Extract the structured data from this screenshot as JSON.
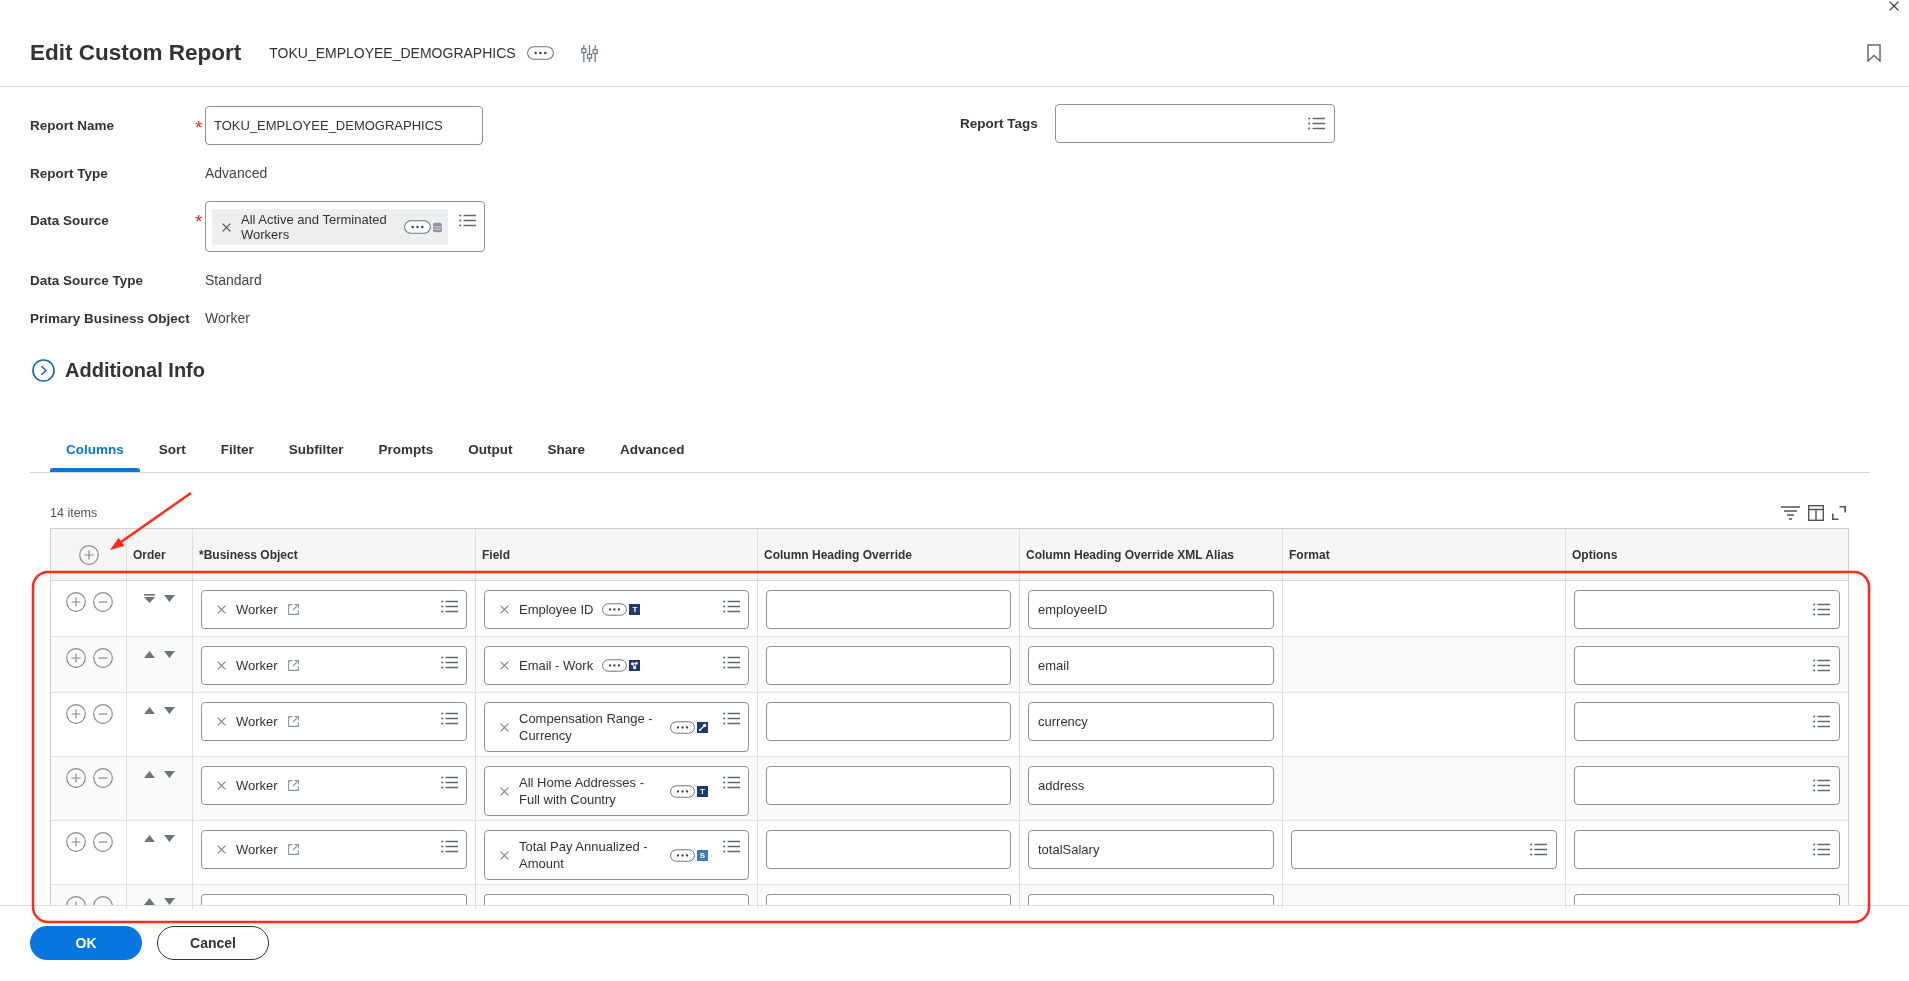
{
  "header": {
    "title": "Edit Custom Report",
    "subtitle": "TOKU_EMPLOYEE_DEMOGRAPHICS"
  },
  "form": {
    "fields": [
      {
        "label": "Report Name",
        "required_mark": "*",
        "kind": "text_input",
        "value": "TOKU_EMPLOYEE_DEMOGRAPHICS"
      },
      {
        "label": "Report Type",
        "kind": "static",
        "value": "Advanced"
      },
      {
        "label": "Data Source",
        "required_mark": "*",
        "kind": "chip_select",
        "value": "All Active and Terminated Workers"
      },
      {
        "label": "Data Source Type",
        "kind": "static",
        "value": "Standard"
      },
      {
        "label": "Primary Business Object",
        "kind": "static",
        "value": "Worker"
      }
    ],
    "side_fields": [
      {
        "label": "Report Tags",
        "kind": "select"
      }
    ]
  },
  "section": {
    "title": "Additional Info",
    "expanded": false
  },
  "tabs": [
    {
      "label": "Columns",
      "selected": true
    },
    {
      "label": "Sort",
      "selected": false
    },
    {
      "label": "Filter",
      "selected": false
    },
    {
      "label": "Subfilter",
      "selected": false
    },
    {
      "label": "Prompts",
      "selected": false
    },
    {
      "label": "Output",
      "selected": false
    },
    {
      "label": "Share",
      "selected": false
    },
    {
      "label": "Advanced",
      "selected": false
    }
  ],
  "table": {
    "count": "14 items",
    "columns": [
      {
        "kind": "add"
      },
      {
        "kind": "text",
        "label": "Order"
      },
      {
        "kind": "text",
        "label": "*Business Object"
      },
      {
        "kind": "text",
        "label": "Field"
      },
      {
        "kind": "text",
        "label": "Column Heading Override"
      },
      {
        "kind": "text",
        "label": "Column Heading Override XML Alias"
      },
      {
        "kind": "text",
        "label": "Format"
      },
      {
        "kind": "text",
        "label": "Options"
      }
    ],
    "rows": [
      {
        "kind": "full",
        "can_move_up": false,
        "business_object": "Worker",
        "field": {
          "text": "Employee ID",
          "type_icon": {
            "kind": "letter",
            "label": "T",
            "color": "#1e3a6e"
          }
        },
        "xml_alias": "employeeID",
        "format_select": false
      },
      {
        "kind": "full",
        "can_move_up": true,
        "business_object": "Worker",
        "field": {
          "text": "Email - Work",
          "type_icon": {
            "kind": "multi",
            "color": "#1e3a6e"
          }
        },
        "xml_alias": "email",
        "format_select": false
      },
      {
        "kind": "full",
        "can_move_up": true,
        "business_object": "Worker",
        "field": {
          "text": "Compensation Range - Currency",
          "type_icon": {
            "kind": "single",
            "color": "#1e3a6e"
          }
        },
        "xml_alias": "currency",
        "format_select": false
      },
      {
        "kind": "full",
        "can_move_up": true,
        "business_object": "Worker",
        "field": {
          "text": "All Home Addresses - Full with Country",
          "type_icon": {
            "kind": "letter",
            "label": "T",
            "color": "#1e3a6e"
          }
        },
        "xml_alias": "address",
        "format_select": false
      },
      {
        "kind": "full",
        "can_move_up": true,
        "business_object": "Worker",
        "field": {
          "text": "Total Pay Annualized - Amount",
          "type_icon": {
            "kind": "letter",
            "label": "S",
            "color": "#3c7ab8"
          }
        },
        "xml_alias": "totalSalary",
        "format_select": true
      },
      {
        "kind": "partial",
        "can_move_up": true,
        "format_select": false
      }
    ]
  },
  "footer": {
    "buttons": [
      {
        "label": "OK",
        "kind": "primary"
      },
      {
        "label": "Cancel",
        "kind": "secondary"
      }
    ]
  }
}
